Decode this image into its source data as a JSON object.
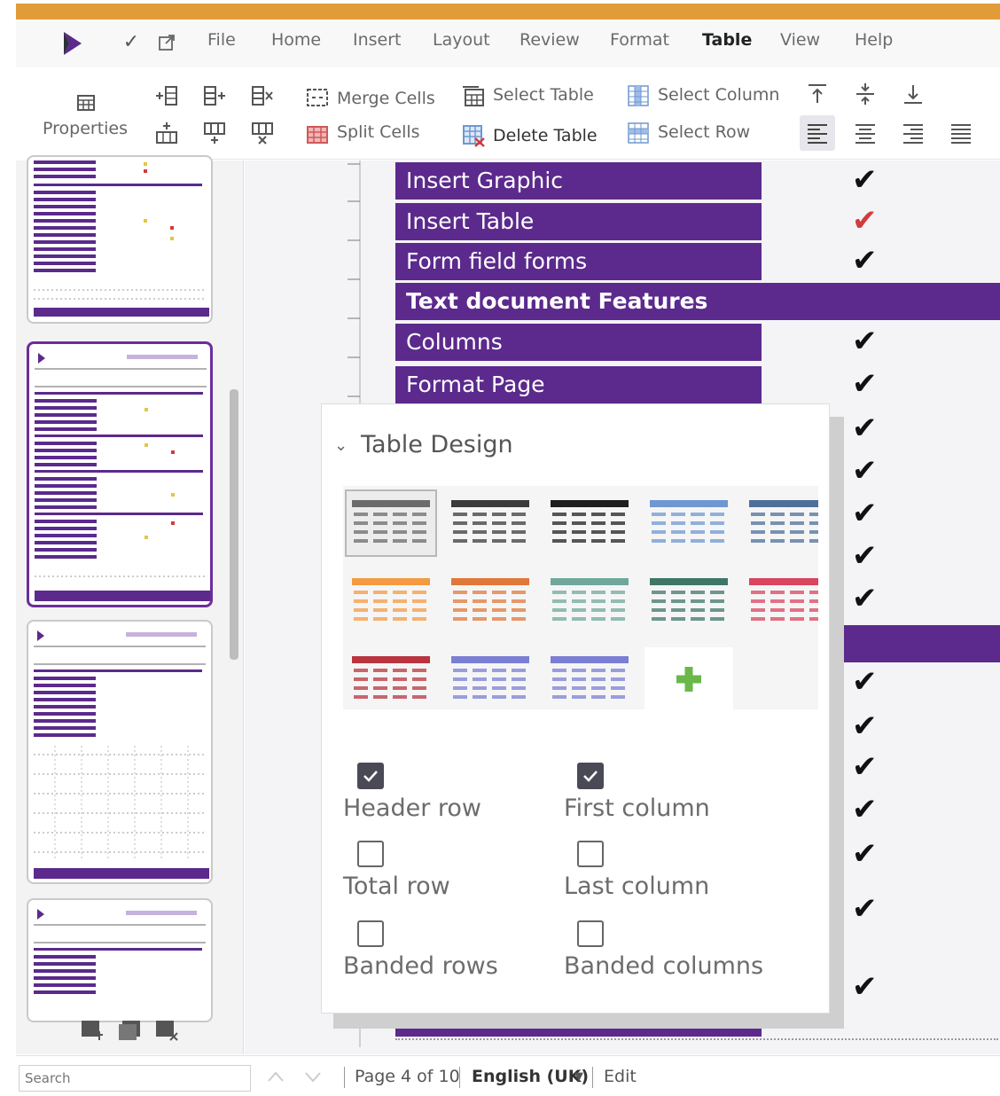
{
  "menubar": {
    "items": [
      "File",
      "Home",
      "Insert",
      "Layout",
      "Review",
      "Format",
      "Table",
      "View",
      "Help"
    ],
    "active": "Table"
  },
  "toolbar": {
    "properties": "Properties",
    "merge_cells": "Merge Cells",
    "split_cells": "Split Cells",
    "select_table": "Select Table",
    "delete_table": "Delete Table",
    "select_column": "Select Column",
    "select_row": "Select Row"
  },
  "document": {
    "rows": [
      {
        "label": "Insert Graphic",
        "check": "✔",
        "check_color": "#111111"
      },
      {
        "label": "Insert Table",
        "check": "✔",
        "check_color": "#d23b3b"
      },
      {
        "label": "Form field forms",
        "check": "✔",
        "check_color": "#111111"
      },
      {
        "label": "Text document Features",
        "section": true
      },
      {
        "label": "Columns",
        "check": "✔",
        "check_color": "#111111"
      },
      {
        "label": "Format Page",
        "check": "✔",
        "check_color": "#111111"
      }
    ],
    "visible_checks": [
      "✔",
      "✔",
      "✔",
      "✔",
      "✔",
      "✔",
      "✔",
      "✔",
      "✔",
      "✔",
      "✔",
      "✔",
      "✔"
    ],
    "accent_color": "#5b2a8c"
  },
  "panel": {
    "title": "Table Design",
    "options": [
      {
        "label": "Header row",
        "checked": true
      },
      {
        "label": "First column",
        "checked": true
      },
      {
        "label": "Total row",
        "checked": false
      },
      {
        "label": "Last column",
        "checked": false
      },
      {
        "label": "Banded rows",
        "checked": false
      },
      {
        "label": "Banded columns",
        "checked": false
      }
    ],
    "style_colors": [
      "#6b6b6b",
      "#3b3b3b",
      "#1f1f1f",
      "#6f97d1",
      "#4e6f99",
      "#f39a42",
      "#e0783a",
      "#6fa89b",
      "#3f7668",
      "#d9445f",
      "#b8343f",
      "#7b7fd4",
      "#7b7fd4",
      "add"
    ]
  },
  "statusbar": {
    "search_placeholder": "Search",
    "page": "Page 4 of 10",
    "language": "English (UK)",
    "mode": "Edit"
  }
}
